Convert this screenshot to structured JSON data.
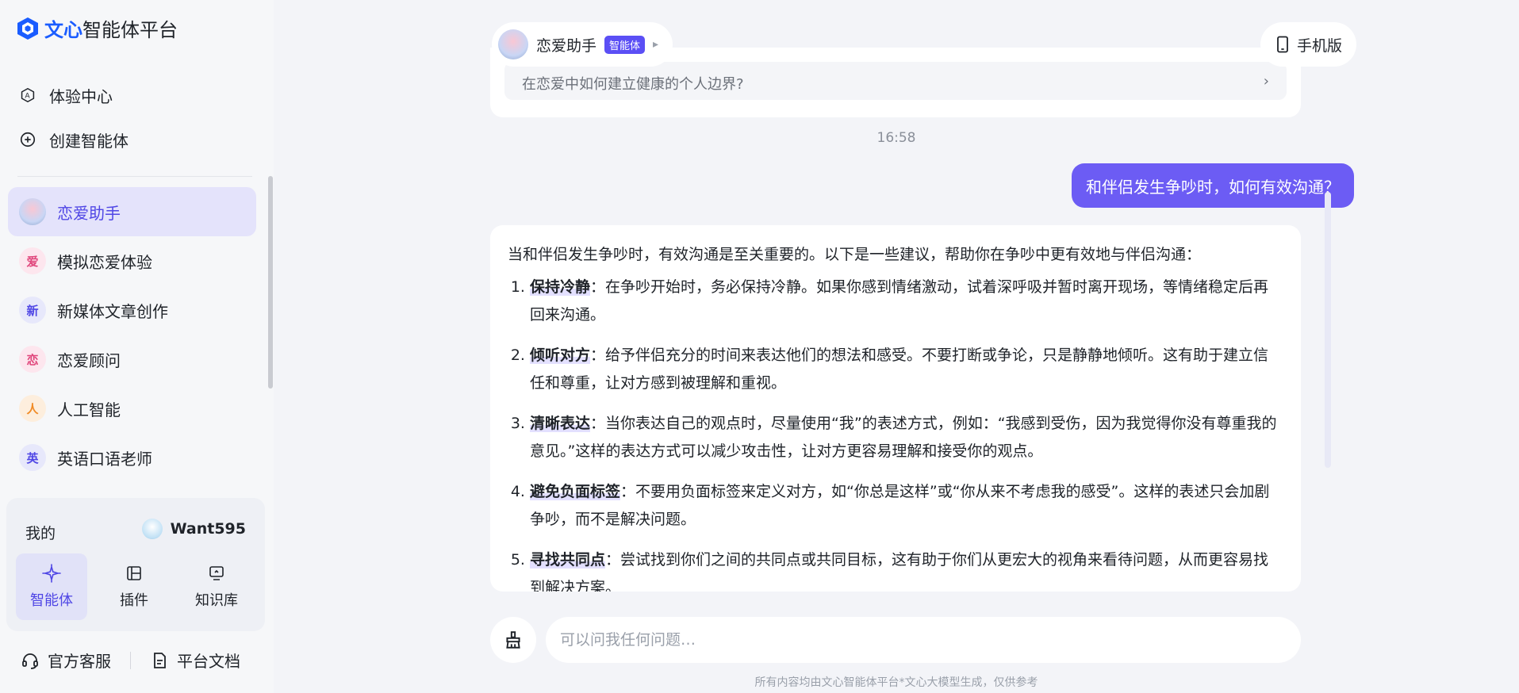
{
  "brand": {
    "bold": "文心",
    "rest": "智能体平台"
  },
  "nav_top": [
    {
      "label": "体验中心",
      "icon": "explore-icon"
    },
    {
      "label": "创建智能体",
      "icon": "plus-circle-icon"
    }
  ],
  "agents": [
    {
      "name": "恋爱助手",
      "avatar": "",
      "color": "#4f46e5",
      "active": true
    },
    {
      "name": "模拟恋爱体验",
      "avatar": "爱",
      "color": "#e0457b"
    },
    {
      "name": "新媒体文章创作",
      "avatar": "新",
      "color": "#4f46e5"
    },
    {
      "name": "恋爱顾问",
      "avatar": "恋",
      "color": "#e0457b"
    },
    {
      "name": "人工智能",
      "avatar": "人",
      "color": "#f08a24"
    },
    {
      "name": "英语口语老师",
      "avatar": "英",
      "color": "#4f46e5"
    }
  ],
  "mine": {
    "title": "我的",
    "username": "Want595",
    "tools": [
      {
        "label": "智能体",
        "icon": "sparkle-icon",
        "active": true
      },
      {
        "label": "插件",
        "icon": "plugin-icon"
      },
      {
        "label": "知识库",
        "icon": "knowledge-icon"
      }
    ]
  },
  "bottom_links": {
    "support": "官方客服",
    "docs": "平台文档"
  },
  "header": {
    "agent_name": "恋爱助手",
    "badge": "智能体",
    "mobile": "手机版"
  },
  "prev_suggestion": "在恋爱中如何建立健康的个人边界?",
  "timestamp": "16:58",
  "user_message": "和伴侣发生争吵时，如何有效沟通？",
  "answer": {
    "intro": "当和伴侣发生争吵时，有效沟通是至关重要的。以下是一些建议，帮助你在争吵中更有效地与伴侣沟通：",
    "items": [
      {
        "title": "保持冷静",
        "text": "：在争吵开始时，务必保持冷静。如果你感到情绪激动，试着深呼吸并暂时离开现场，等情绪稳定后再回来沟通。"
      },
      {
        "title": "倾听对方",
        "text": "：给予伴侣充分的时间来表达他们的想法和感受。不要打断或争论，只是静静地倾听。这有助于建立信任和尊重，让对方感到被理解和重视。"
      },
      {
        "title": "清晰表达",
        "text": "：当你表达自己的观点时，尽量使用“我”的表述方式，例如：“我感到受伤，因为我觉得你没有尊重我的意见。”这样的表达方式可以减少攻击性，让对方更容易理解和接受你的观点。"
      },
      {
        "title": "避免负面标签",
        "text": "：不要用负面标签来定义对方，如“你总是这样”或“你从来不考虑我的感受”。这样的表述只会加剧争吵，而不是解决问题。"
      },
      {
        "title": "寻找共同点",
        "text": "：尝试找到你们之间的共同点或共同目标，这有助于你们从更宏大的视角来看待问题，从而更容易找到解决方案。"
      }
    ]
  },
  "input": {
    "placeholder": "可以问我任何问题…"
  },
  "footnote": "所有内容均由文心智能体平台*文心大模型生成，仅供参考",
  "colors": {
    "accent": "#6c5cf4",
    "brand": "#1a5cff"
  }
}
